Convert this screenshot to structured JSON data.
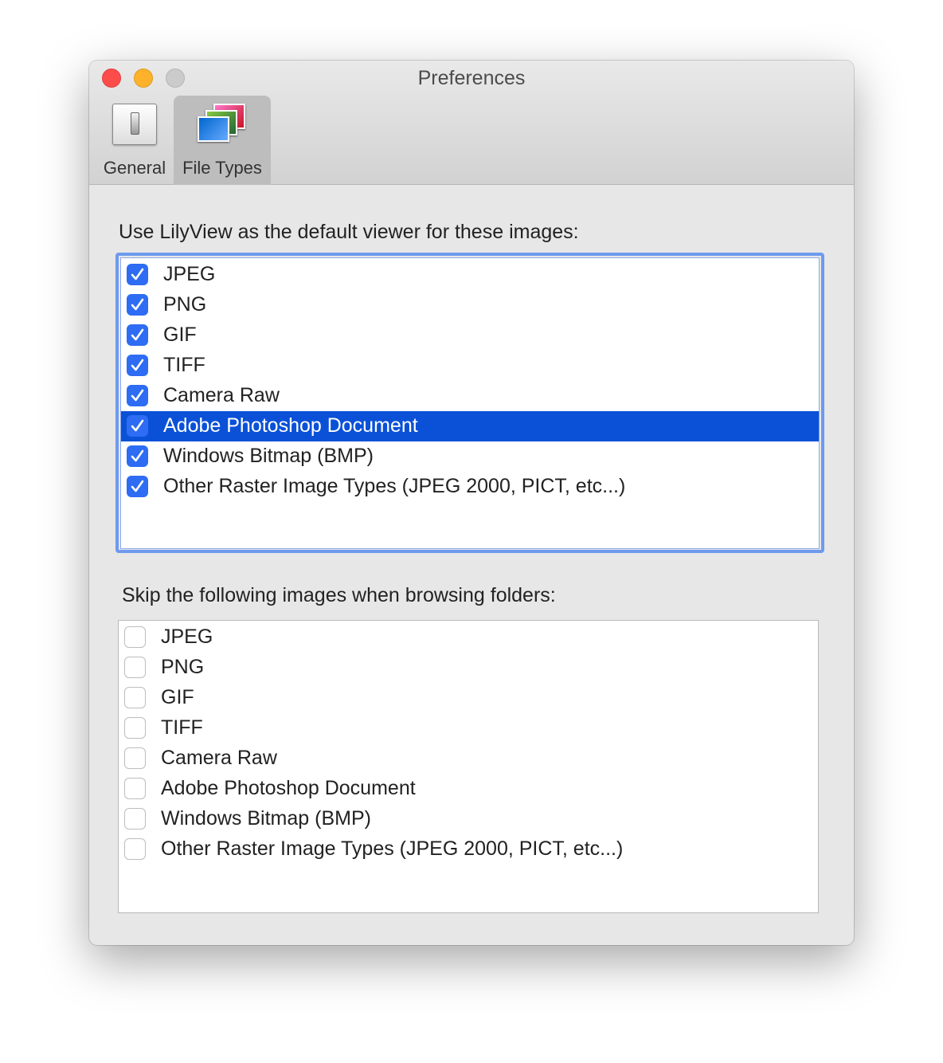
{
  "window": {
    "title": "Preferences"
  },
  "tabs": [
    {
      "label": "General",
      "icon": "switch-icon"
    },
    {
      "label": "File Types",
      "icon": "photos-icon",
      "selected": true
    }
  ],
  "default_viewer": {
    "heading": "Use LilyView as the default viewer for these images:",
    "items": [
      {
        "label": "JPEG",
        "checked": true
      },
      {
        "label": "PNG",
        "checked": true
      },
      {
        "label": "GIF",
        "checked": true
      },
      {
        "label": "TIFF",
        "checked": true
      },
      {
        "label": "Camera Raw",
        "checked": true
      },
      {
        "label": "Adobe Photoshop Document",
        "checked": true,
        "selected": true
      },
      {
        "label": "Windows Bitmap (BMP)",
        "checked": true
      },
      {
        "label": "Other Raster Image Types (JPEG 2000, PICT, etc...)",
        "checked": true
      }
    ]
  },
  "skip": {
    "heading": "Skip the following images when browsing folders:",
    "items": [
      {
        "label": "JPEG",
        "checked": false
      },
      {
        "label": "PNG",
        "checked": false
      },
      {
        "label": "GIF",
        "checked": false
      },
      {
        "label": "TIFF",
        "checked": false
      },
      {
        "label": "Camera Raw",
        "checked": false
      },
      {
        "label": "Adobe Photoshop Document",
        "checked": false
      },
      {
        "label": "Windows Bitmap (BMP)",
        "checked": false
      },
      {
        "label": "Other Raster Image Types (JPEG 2000, PICT, etc...)",
        "checked": false
      }
    ]
  },
  "colors": {
    "accent": "#2d6cf3",
    "selection": "#0a51d7",
    "close": "#fd4d4a",
    "minimize": "#feb22c",
    "zoom": "#cbcbcb"
  }
}
